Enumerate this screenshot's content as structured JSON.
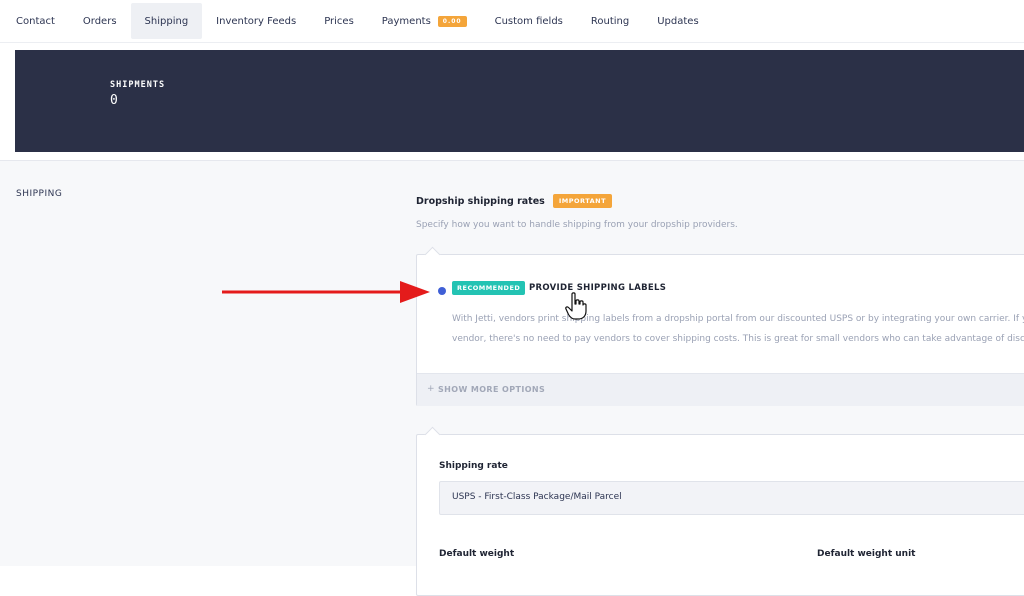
{
  "tabs": [
    {
      "label": "Contact"
    },
    {
      "label": "Orders"
    },
    {
      "label": "Shipping",
      "active": true
    },
    {
      "label": "Inventory Feeds"
    },
    {
      "label": "Prices"
    },
    {
      "label": "Payments",
      "badge": "0.00"
    },
    {
      "label": "Custom fields"
    },
    {
      "label": "Routing"
    },
    {
      "label": "Updates"
    }
  ],
  "banner": {
    "label": "SHIPMENTS",
    "value": "0"
  },
  "section": {
    "title": "SHIPPING"
  },
  "dropship": {
    "heading": "Dropship shipping rates",
    "badge": "IMPORTANT",
    "subtext": "Specify how you want to handle shipping from your dropship providers.",
    "option": {
      "badge": "RECOMMENDED",
      "title": "PROVIDE SHIPPING LABELS",
      "description_line1": "With Jetti, vendors print shipping labels from a dropship portal from our discounted USPS or by integrating your own carrier. If you su",
      "description_line2": "vendor, there's no need to pay vendors to cover shipping costs. This is great for small vendors who can take advantage of discounted r"
    },
    "more_options": {
      "icon": "+",
      "label": "SHOW MORE OPTIONS"
    }
  },
  "rate": {
    "label": "Shipping rate",
    "selected": "USPS - First-Class Package/Mail Parcel",
    "default_weight_label": "Default weight",
    "default_weight_unit_label": "Default weight unit"
  },
  "colors": {
    "banner_bg": "#2b3047",
    "important": "#f4a53a",
    "recommended": "#23c3b3",
    "radio": "#3f5fd6",
    "arrow": "#e41b1b"
  }
}
